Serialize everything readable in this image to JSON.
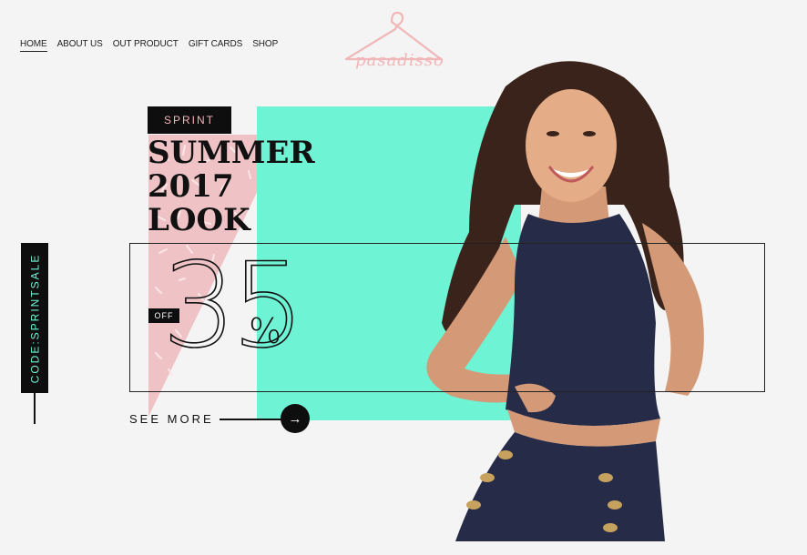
{
  "nav": {
    "items": [
      {
        "label": "HOME",
        "active": true
      },
      {
        "label": "ABOUT US"
      },
      {
        "label": "OUT PRODUCT"
      },
      {
        "label": "GIFT CARDS"
      },
      {
        "label": "SHOP"
      }
    ]
  },
  "logo": {
    "text": "pasadisso",
    "icon": "hanger-icon"
  },
  "hero": {
    "tag": "SPRINT",
    "headline": [
      "SUMMER",
      "2017",
      "LOOK"
    ],
    "off_label": "OFF",
    "discount": "35",
    "percent": "%",
    "see_more": "SEE MORE",
    "arrow_icon": "arrow-right-icon"
  },
  "code": {
    "text": "CODE:SPRINTSALE"
  },
  "colors": {
    "accent_teal": "#6ff3d5",
    "accent_pink": "#f0b6b8",
    "dark": "#0e0e0e",
    "background": "#f4f4f4"
  }
}
